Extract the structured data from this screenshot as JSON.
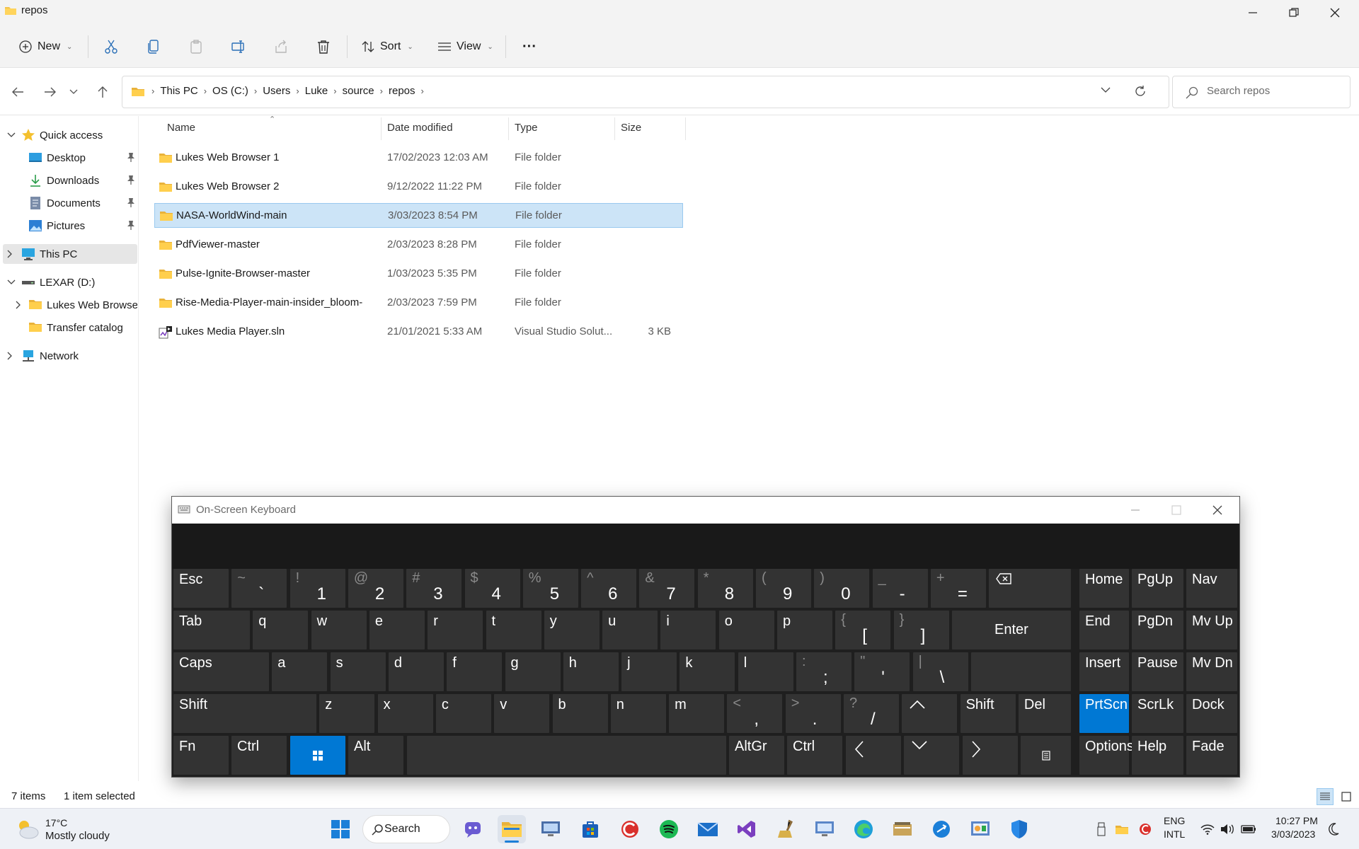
{
  "window": {
    "title": "repos"
  },
  "command_bar": {
    "new_label": "New",
    "sort_label": "Sort",
    "view_label": "View",
    "more_label": "···"
  },
  "breadcrumb": [
    "This PC",
    "OS (C:)",
    "Users",
    "Luke",
    "source",
    "repos"
  ],
  "search": {
    "placeholder": "Search repos"
  },
  "nav": {
    "quick_access": "Quick access",
    "desktop": "Desktop",
    "downloads": "Downloads",
    "documents": "Documents",
    "pictures": "Pictures",
    "this_pc": "This PC",
    "lexar": "LEXAR (D:)",
    "lexar_child1": "Lukes Web Browser",
    "lexar_child2": "Transfer catalog",
    "network": "Network"
  },
  "columns": {
    "name": "Name",
    "date": "Date modified",
    "type": "Type",
    "size": "Size"
  },
  "files": [
    {
      "name": "Lukes Web Browser 1",
      "date": "17/02/2023 12:03 AM",
      "type": "File folder",
      "size": "",
      "kind": "folder"
    },
    {
      "name": "Lukes Web Browser 2",
      "date": "9/12/2022 11:22 PM",
      "type": "File folder",
      "size": "",
      "kind": "folder"
    },
    {
      "name": "NASA-WorldWind-main",
      "date": "3/03/2023 8:54 PM",
      "type": "File folder",
      "size": "",
      "kind": "folder"
    },
    {
      "name": "PdfViewer-master",
      "date": "2/03/2023 8:28 PM",
      "type": "File folder",
      "size": "",
      "kind": "folder"
    },
    {
      "name": "Pulse-Ignite-Browser-master",
      "date": "1/03/2023 5:35 PM",
      "type": "File folder",
      "size": "",
      "kind": "folder"
    },
    {
      "name": "Rise-Media-Player-main-insider_bloom-",
      "date": "2/03/2023 7:59 PM",
      "type": "File folder",
      "size": "",
      "kind": "folder"
    },
    {
      "name": "Lukes Media Player.sln",
      "date": "21/01/2021 5:33 AM",
      "type": "Visual Studio Solut...",
      "size": "3 KB",
      "kind": "sln"
    }
  ],
  "status": {
    "items": "7 items",
    "selected": "1 item selected"
  },
  "osk": {
    "title": "On-Screen Keyboard",
    "row1": [
      {
        "label": "Esc"
      },
      {
        "shift": "~",
        "main": "`"
      },
      {
        "shift": "!",
        "main": "1"
      },
      {
        "shift": "@",
        "main": "2"
      },
      {
        "shift": "#",
        "main": "3"
      },
      {
        "shift": "$",
        "main": "4"
      },
      {
        "shift": "%",
        "main": "5"
      },
      {
        "shift": "^",
        "main": "6"
      },
      {
        "shift": "&",
        "main": "7"
      },
      {
        "shift": "*",
        "main": "8"
      },
      {
        "shift": "(",
        "main": "9"
      },
      {
        "shift": ")",
        "main": "0"
      },
      {
        "shift": "_",
        "main": "-"
      },
      {
        "shift": "+",
        "main": "="
      }
    ],
    "row2": [
      {
        "label": "Tab"
      },
      {
        "label": "q"
      },
      {
        "label": "w"
      },
      {
        "label": "e"
      },
      {
        "label": "r"
      },
      {
        "label": "t"
      },
      {
        "label": "y"
      },
      {
        "label": "u"
      },
      {
        "label": "i"
      },
      {
        "label": "o"
      },
      {
        "label": "p"
      },
      {
        "shift": "{",
        "main": "["
      },
      {
        "shift": "}",
        "main": "]"
      },
      {
        "label": "Enter"
      }
    ],
    "row3": [
      {
        "label": "Caps"
      },
      {
        "label": "a"
      },
      {
        "label": "s"
      },
      {
        "label": "d"
      },
      {
        "label": "f"
      },
      {
        "label": "g"
      },
      {
        "label": "h"
      },
      {
        "label": "j"
      },
      {
        "label": "k"
      },
      {
        "label": "l"
      },
      {
        "shift": ":",
        "main": ";"
      },
      {
        "shift": "\"",
        "main": "'"
      },
      {
        "shift": "|",
        "main": "\\"
      }
    ],
    "row4": [
      {
        "label": "Shift"
      },
      {
        "label": "z"
      },
      {
        "label": "x"
      },
      {
        "label": "c"
      },
      {
        "label": "v"
      },
      {
        "label": "b"
      },
      {
        "label": "n"
      },
      {
        "label": "m"
      },
      {
        "shift": "<",
        "main": ","
      },
      {
        "shift": ">",
        "main": "."
      },
      {
        "shift": "?",
        "main": "/"
      },
      {
        "label": "^"
      },
      {
        "label": "Shift"
      },
      {
        "label": "Del"
      }
    ],
    "row5": {
      "fn": "Fn",
      "ctrl": "Ctrl",
      "alt": "Alt",
      "altgr": "AltGr",
      "ctrl2": "Ctrl"
    },
    "right": [
      [
        "Home",
        "PgUp",
        "Nav"
      ],
      [
        "End",
        "PgDn",
        "Mv Up"
      ],
      [
        "Insert",
        "Pause",
        "Mv Dn"
      ],
      [
        "PrtScn",
        "ScrLk",
        "Dock"
      ],
      [
        "Options",
        "Help",
        "Fade"
      ]
    ]
  },
  "taskbar": {
    "weather_temp": "17°C",
    "weather_desc": "Mostly cloudy",
    "search_label": "Search",
    "lang1": "ENG",
    "lang2": "INTL",
    "time": "10:27 PM",
    "date": "3/03/2023"
  }
}
